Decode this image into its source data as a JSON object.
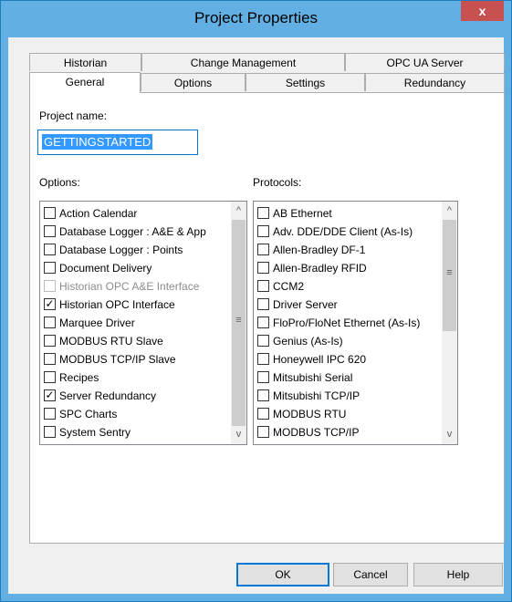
{
  "dialog": {
    "title": "Project Properties",
    "close_glyph": "x"
  },
  "tabs_row1": [
    "Historian",
    "Change Management",
    "OPC UA Server"
  ],
  "tabs_row2": [
    "General",
    "Options",
    "Settings",
    "Redundancy"
  ],
  "active_tab": "General",
  "project_name": {
    "label": "Project name:",
    "value": "GETTINGSTARTED"
  },
  "options": {
    "label": "Options:",
    "items": [
      {
        "label": "Action Calendar",
        "checked": false,
        "enabled": true
      },
      {
        "label": "Database Logger : A&E & App",
        "checked": false,
        "enabled": true
      },
      {
        "label": "Database Logger : Points",
        "checked": false,
        "enabled": true
      },
      {
        "label": "Document Delivery",
        "checked": false,
        "enabled": true
      },
      {
        "label": "Historian OPC A&E Interface",
        "checked": false,
        "enabled": false
      },
      {
        "label": "Historian OPC Interface",
        "checked": true,
        "enabled": true
      },
      {
        "label": "Marquee Driver",
        "checked": false,
        "enabled": true
      },
      {
        "label": "MODBUS RTU Slave",
        "checked": false,
        "enabled": true
      },
      {
        "label": "MODBUS TCP/IP Slave",
        "checked": false,
        "enabled": true
      },
      {
        "label": "Recipes",
        "checked": false,
        "enabled": true
      },
      {
        "label": "Server Redundancy",
        "checked": true,
        "enabled": true
      },
      {
        "label": "SPC Charts",
        "checked": false,
        "enabled": true
      },
      {
        "label": "System Sentry",
        "checked": false,
        "enabled": true
      }
    ]
  },
  "protocols": {
    "label": "Protocols:",
    "items": [
      {
        "label": "AB Ethernet",
        "checked": false
      },
      {
        "label": "Adv. DDE/DDE Client (As-Is)",
        "checked": false
      },
      {
        "label": "Allen-Bradley DF-1",
        "checked": false
      },
      {
        "label": "Allen-Bradley RFID",
        "checked": false
      },
      {
        "label": "CCM2",
        "checked": false
      },
      {
        "label": "Driver Server",
        "checked": false
      },
      {
        "label": "FloPro/FloNet Ethernet (As-Is)",
        "checked": false
      },
      {
        "label": "Genius (As-Is)",
        "checked": false
      },
      {
        "label": "Honeywell IPC 620",
        "checked": false
      },
      {
        "label": "Mitsubishi Serial",
        "checked": false
      },
      {
        "label": "Mitsubishi TCP/IP",
        "checked": false
      },
      {
        "label": "MODBUS RTU",
        "checked": false
      },
      {
        "label": "MODBUS TCP/IP",
        "checked": false
      }
    ]
  },
  "scroll_glyphs": {
    "up": "^",
    "down": "v",
    "grip": "≡",
    "check": "✓"
  },
  "buttons": {
    "ok": "OK",
    "cancel": "Cancel",
    "help": "Help"
  },
  "colors": {
    "title_bar": "#62b0e3",
    "close_button": "#c75050",
    "selection": "#3399ff",
    "focus_border": "#0078d7"
  }
}
